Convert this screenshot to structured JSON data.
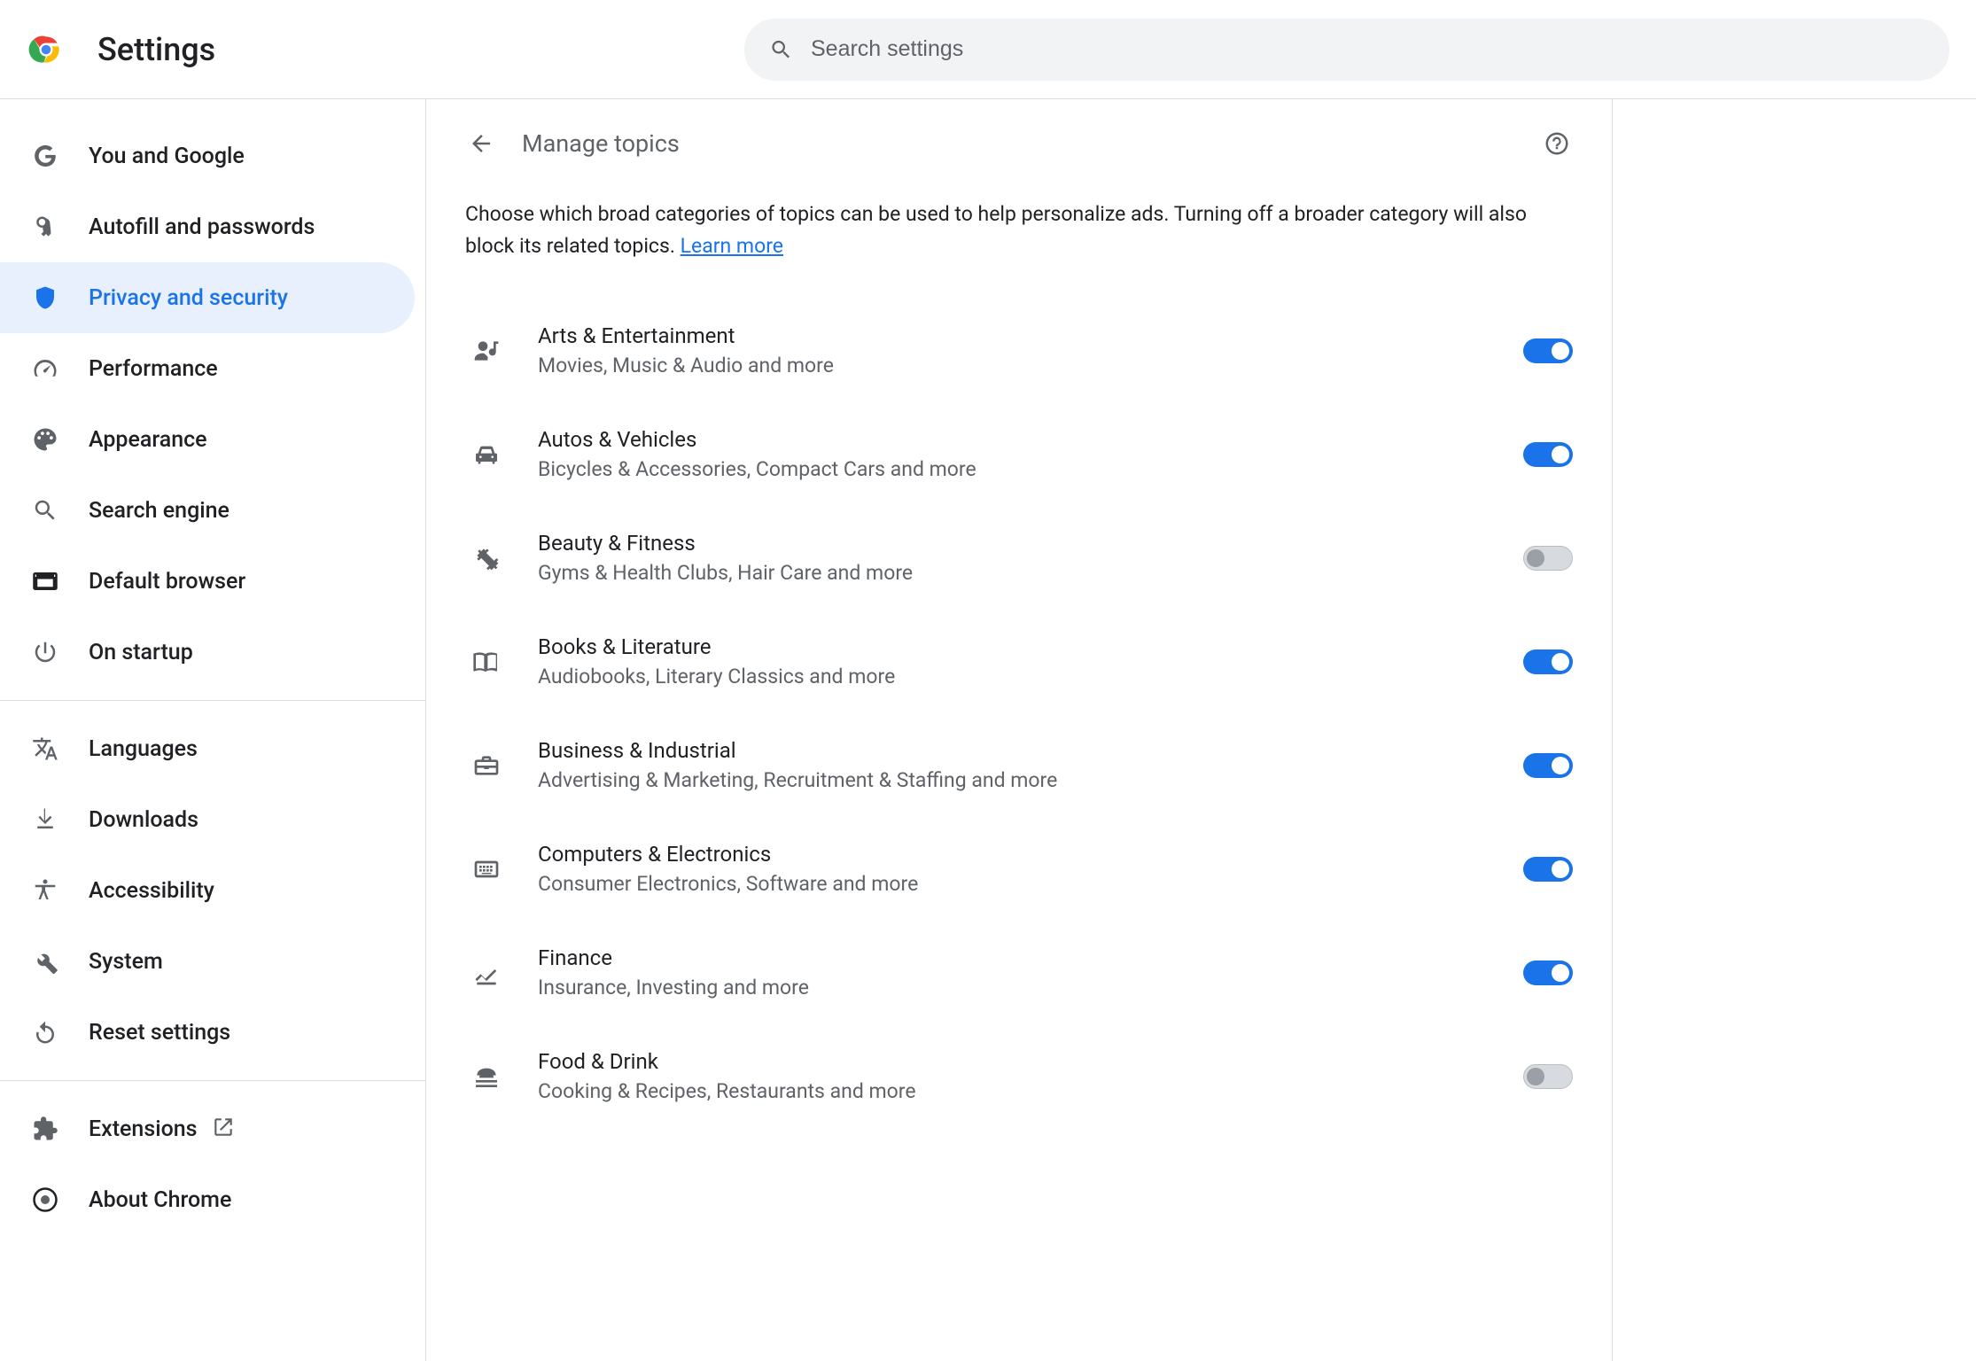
{
  "app_title": "Settings",
  "search_placeholder": "Search settings",
  "sidebar": {
    "items": [
      {
        "id": "you-and-google",
        "label": "You and Google",
        "icon": "google",
        "active": false
      },
      {
        "id": "autofill",
        "label": "Autofill and passwords",
        "icon": "key",
        "active": false
      },
      {
        "id": "privacy",
        "label": "Privacy and security",
        "icon": "shield",
        "active": true
      },
      {
        "id": "performance",
        "label": "Performance",
        "icon": "speed",
        "active": false
      },
      {
        "id": "appearance",
        "label": "Appearance",
        "icon": "palette",
        "active": false
      },
      {
        "id": "search-engine",
        "label": "Search engine",
        "icon": "search",
        "active": false
      },
      {
        "id": "default-browser",
        "label": "Default browser",
        "icon": "browser",
        "active": false
      },
      {
        "id": "on-startup",
        "label": "On startup",
        "icon": "power",
        "active": false
      }
    ],
    "items2": [
      {
        "id": "languages",
        "label": "Languages",
        "icon": "translate",
        "active": false
      },
      {
        "id": "downloads",
        "label": "Downloads",
        "icon": "download",
        "active": false
      },
      {
        "id": "accessibility",
        "label": "Accessibility",
        "icon": "accessibility",
        "active": false
      },
      {
        "id": "system",
        "label": "System",
        "icon": "wrench",
        "active": false
      },
      {
        "id": "reset",
        "label": "Reset settings",
        "icon": "reset",
        "active": false
      }
    ],
    "items3": [
      {
        "id": "extensions",
        "label": "Extensions",
        "icon": "extension",
        "active": false,
        "external": true
      },
      {
        "id": "about",
        "label": "About Chrome",
        "icon": "chrome-small",
        "active": false
      }
    ]
  },
  "page": {
    "title": "Manage topics",
    "description_prefix": "Choose which broad categories of topics can be used to help personalize ads. Turning off a broader category will also block its related topics. ",
    "learn_more": "Learn more"
  },
  "topics": [
    {
      "title": "Arts & Entertainment",
      "subtitle": "Movies, Music & Audio and more",
      "icon": "person-music",
      "on": true
    },
    {
      "title": "Autos & Vehicles",
      "subtitle": "Bicycles & Accessories, Compact Cars and more",
      "icon": "car",
      "on": true
    },
    {
      "title": "Beauty & Fitness",
      "subtitle": "Gyms & Health Clubs, Hair Care and more",
      "icon": "fitness",
      "on": false
    },
    {
      "title": "Books & Literature",
      "subtitle": "Audiobooks, Literary Classics and more",
      "icon": "book",
      "on": true
    },
    {
      "title": "Business & Industrial",
      "subtitle": "Advertising & Marketing, Recruitment & Staffing and more",
      "icon": "briefcase",
      "on": true
    },
    {
      "title": "Computers & Electronics",
      "subtitle": "Consumer Electronics, Software and more",
      "icon": "keyboard",
      "on": true
    },
    {
      "title": "Finance",
      "subtitle": "Insurance, Investing and more",
      "icon": "chart",
      "on": true
    },
    {
      "title": "Food & Drink",
      "subtitle": "Cooking & Recipes, Restaurants and more",
      "icon": "food",
      "on": false
    }
  ]
}
